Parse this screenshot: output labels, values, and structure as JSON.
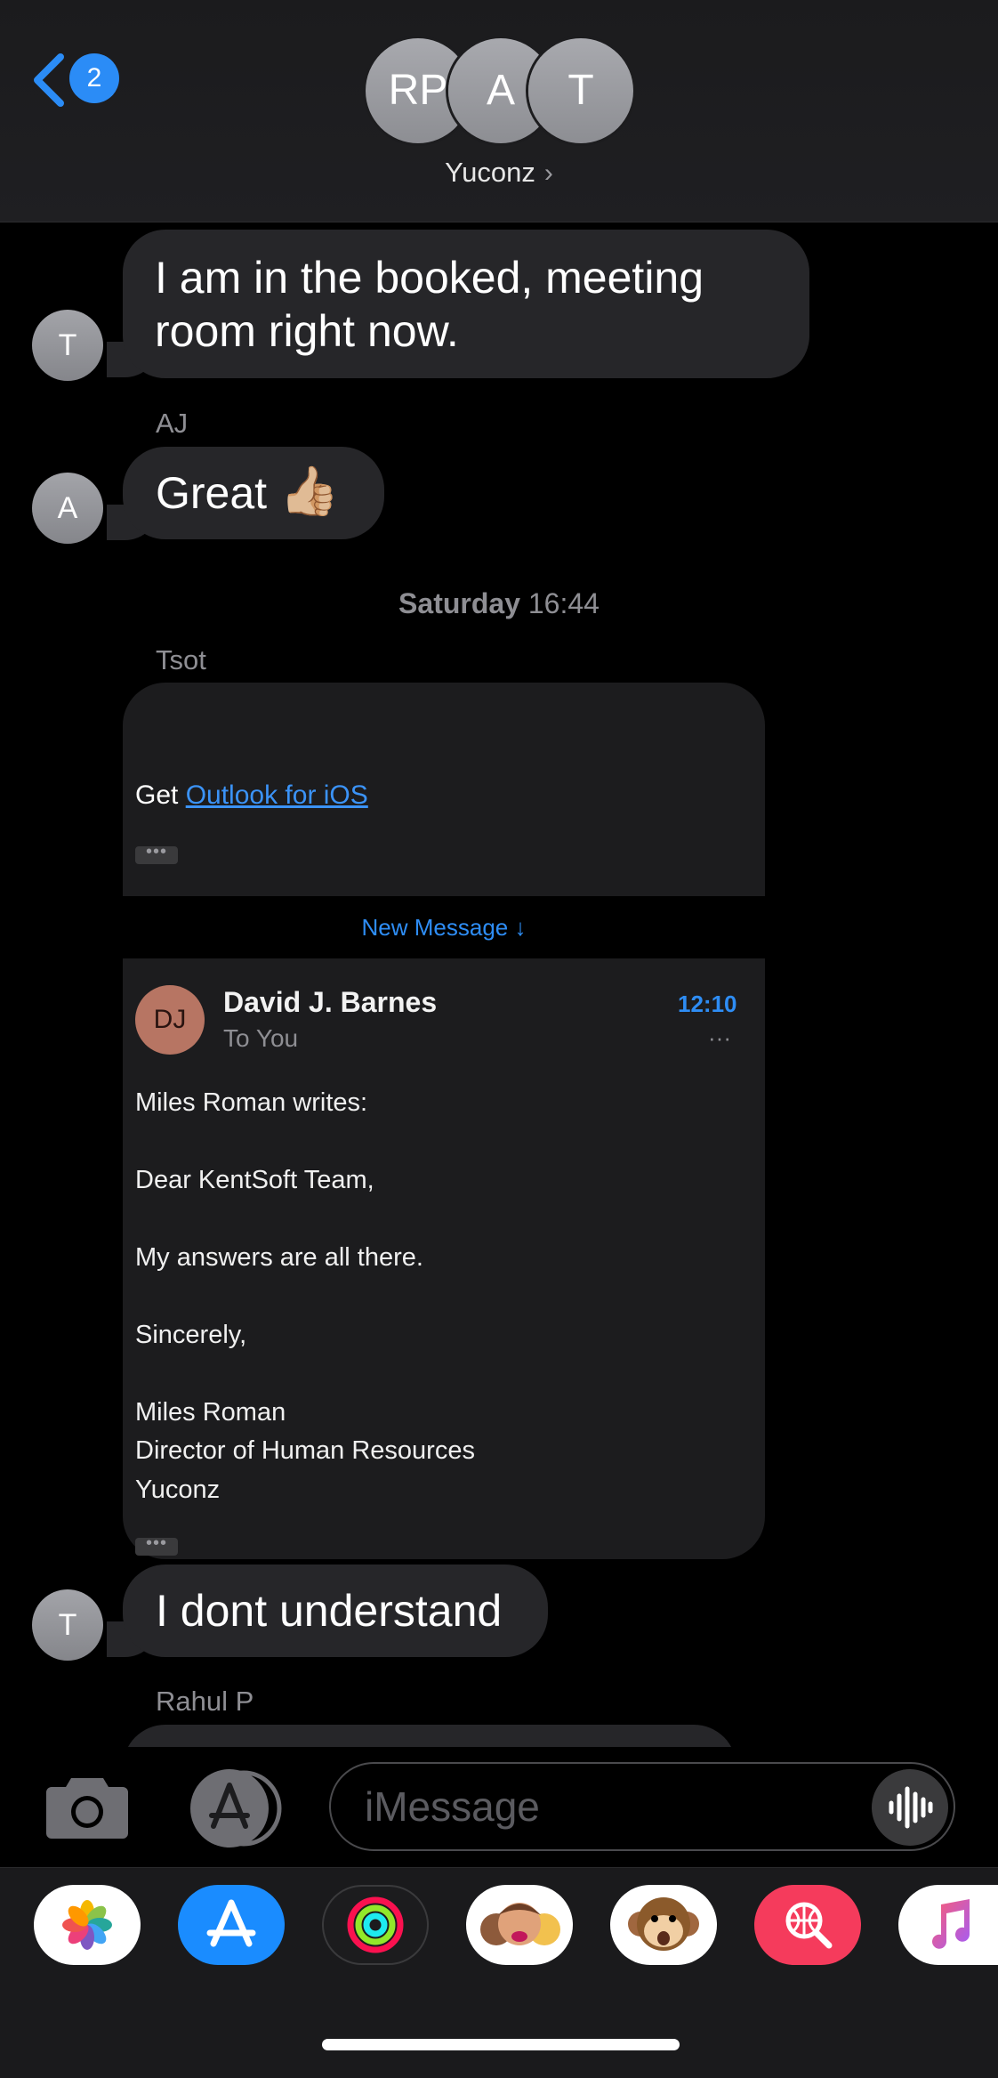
{
  "header": {
    "back_count": "2",
    "avatars": [
      "RP",
      "A",
      "T"
    ],
    "group_name": "Yuconz",
    "chevron": "›"
  },
  "messages": {
    "m1": {
      "avatar": "T",
      "line1": "I am in the booked, meeting",
      "line2": "room right now."
    },
    "m2": {
      "sender": "AJ",
      "avatar": "A",
      "text": "Great",
      "emoji": "👍🏼"
    },
    "timestamp": {
      "day": "Saturday",
      "time": "16:44"
    },
    "m3": {
      "sender": "Tsot",
      "get_text": "Get ",
      "link_text": "Outlook for iOS",
      "new_message_label": "New Message ↓",
      "email": {
        "avatar": "DJ",
        "from": "David J. Barnes",
        "to": "To You",
        "time": "12:10",
        "more": "···",
        "lines": [
          "Miles Roman writes:",
          "Dear KentSoft Team,",
          "My answers are all there.",
          "Sincerely,",
          "Miles Roman",
          "Director of Human Resources",
          "Yuconz"
        ]
      },
      "dots": "•••"
    },
    "m4": {
      "avatar": "T",
      "text": "I dont understand"
    },
    "m5": {
      "sender": "Rahul P"
    }
  },
  "composer": {
    "placeholder": "iMessage"
  },
  "apps": [
    "photos",
    "app-store",
    "activity",
    "memoji-stickers",
    "animoji",
    "web-search",
    "music"
  ],
  "colors": {
    "accent": "#2b8cf6",
    "bubble": "#262629",
    "background": "#000000"
  }
}
